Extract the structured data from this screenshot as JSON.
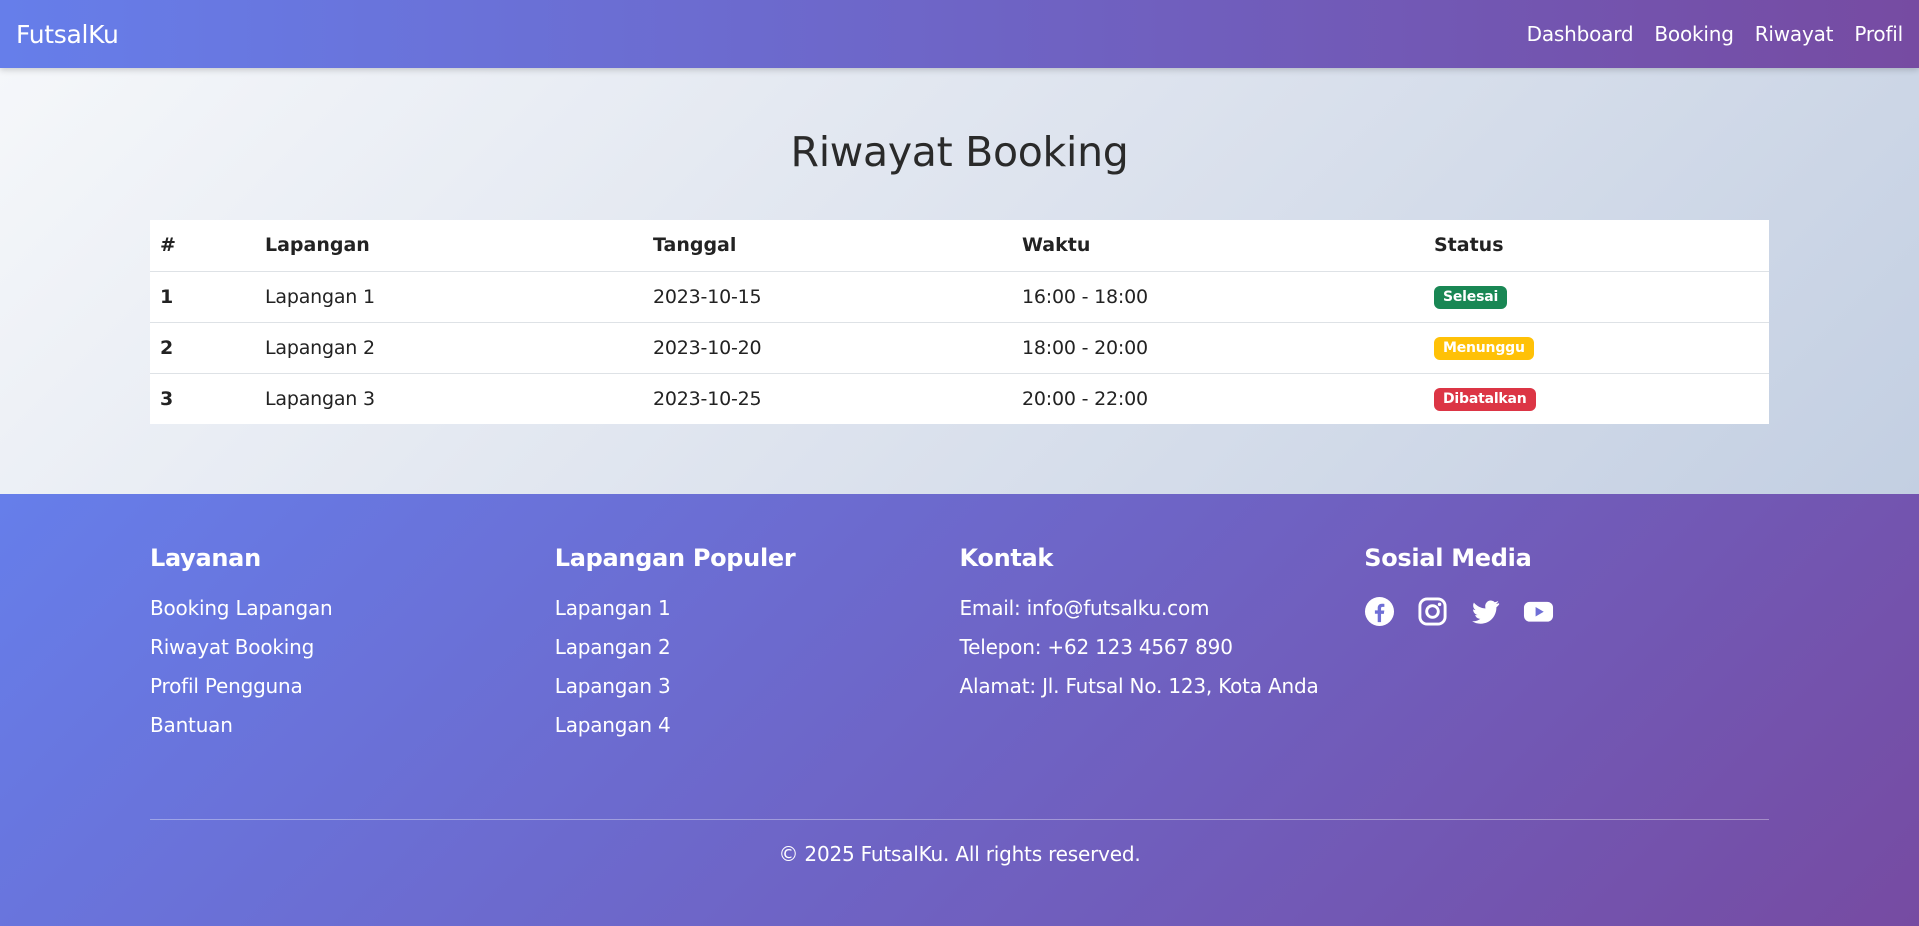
{
  "navbar": {
    "brand": "FutsalKu",
    "links": [
      "Dashboard",
      "Booking",
      "Riwayat",
      "Profil"
    ]
  },
  "page": {
    "title": "Riwayat Booking"
  },
  "table": {
    "headers": [
      "#",
      "Lapangan",
      "Tanggal",
      "Waktu",
      "Status"
    ],
    "rows": [
      {
        "num": "1",
        "lapangan": "Lapangan 1",
        "tanggal": "2023-10-15",
        "waktu": "16:00 - 18:00",
        "status": "Selesai"
      },
      {
        "num": "2",
        "lapangan": "Lapangan 2",
        "tanggal": "2023-10-20",
        "waktu": "18:00 - 20:00",
        "status": "Menunggu"
      },
      {
        "num": "3",
        "lapangan": "Lapangan 3",
        "tanggal": "2023-10-25",
        "waktu": "20:00 - 22:00",
        "status": "Dibatalkan"
      }
    ],
    "status_colors": {
      "Selesai": "#198754",
      "Menunggu": "#ffc107",
      "Dibatalkan": "#dc3545"
    }
  },
  "footer": {
    "layanan": {
      "title": "Layanan",
      "items": [
        "Booking Lapangan",
        "Riwayat Booking",
        "Profil Pengguna",
        "Bantuan"
      ]
    },
    "lapangan": {
      "title": "Lapangan Populer",
      "items": [
        "Lapangan 1",
        "Lapangan 2",
        "Lapangan 3",
        "Lapangan 4"
      ]
    },
    "kontak": {
      "title": "Kontak",
      "items": [
        "Email: info@futsalku.com",
        "Telepon: +62 123 4567 890",
        "Alamat: Jl. Futsal No. 123, Kota Anda"
      ]
    },
    "sosial": {
      "title": "Sosial Media",
      "icons": [
        "facebook-icon",
        "instagram-icon",
        "twitter-icon",
        "youtube-icon"
      ]
    },
    "copyright": "© 2025 FutsalKu. All rights reserved."
  },
  "colors": {
    "gradient_start": "#667eea",
    "gradient_end": "#764ba2"
  }
}
